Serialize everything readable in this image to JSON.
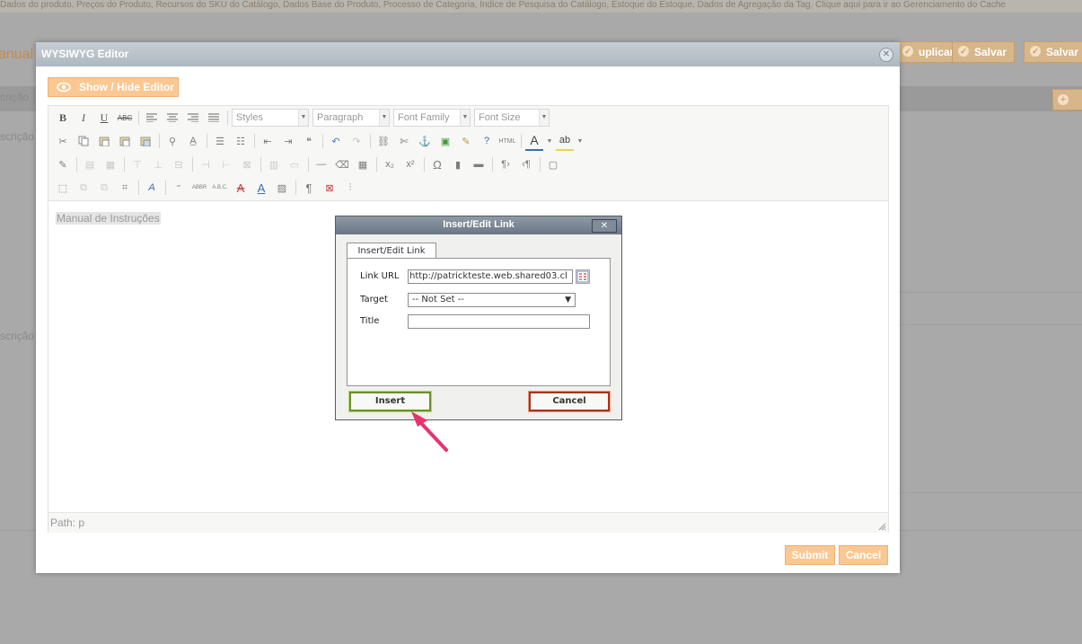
{
  "background": {
    "top_text": "Dados do produto, Preços do Produto, Recursos do SKU do Catálogo, Dados Base do Produto, Processo de Categoria, Índice de Pesquisa do Catálogo, Estoque do Estoque, Dados de Agregação da Tag. Clique aqui para ir ao Gerenciamento do Cache",
    "page_title": "anual d",
    "buttons": {
      "duplicate": "uplicar",
      "save": "Salvar",
      "save_continue": "Salvar"
    },
    "section_label_1": "crição",
    "section_label_2": "scrição",
    "section_label_3": "scrição"
  },
  "wysiwyg": {
    "title": "WYSIWYG Editor",
    "show_hide_label": "Show / Hide Editor",
    "toolbar": {
      "styles_select": "Styles",
      "format_select": "Paragraph",
      "font_family_select": "Font Family",
      "font_size_select": "Font Size"
    },
    "content_text": "Manual de Instruções",
    "path_text": "Path: p",
    "submit_label": "Submit",
    "cancel_label": "Cancel"
  },
  "link_dialog": {
    "title": "Insert/Edit Link",
    "tab_label": "Insert/Edit Link",
    "link_url_label": "Link URL",
    "link_url_value": "http://patrickteste.web.shared03.cl",
    "target_label": "Target",
    "target_value": "-- Not Set --",
    "title_label": "Title",
    "title_value": "",
    "insert_label": "Insert",
    "cancel_label": "Cancel"
  },
  "colors": {
    "accent_orange": "#f9c893",
    "insert_border": "#6a8f2a",
    "cancel_border": "#a7341a",
    "arrow": "#e8336e"
  }
}
